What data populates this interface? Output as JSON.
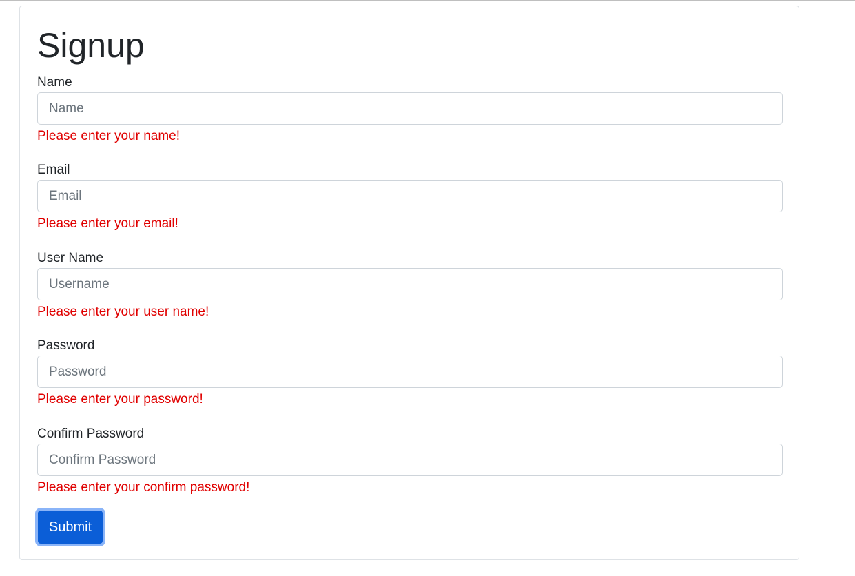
{
  "form": {
    "title": "Signup",
    "fields": [
      {
        "label": "Name",
        "placeholder": "Name",
        "value": "",
        "error": "Please enter your name!"
      },
      {
        "label": "Email",
        "placeholder": "Email",
        "value": "",
        "error": "Please enter your email!"
      },
      {
        "label": "User Name",
        "placeholder": "Username",
        "value": "",
        "error": "Please enter your user name!"
      },
      {
        "label": "Password",
        "placeholder": "Password",
        "value": "",
        "error": "Please enter your password!"
      },
      {
        "label": "Confirm Password",
        "placeholder": "Confirm Password",
        "value": "",
        "error": "Please enter your confirm password!"
      }
    ],
    "submit_label": "Submit"
  },
  "colors": {
    "primary": "#0b5ed7",
    "focus_ring": "#8ab4f8",
    "error": "#e00000",
    "border": "#ced4da",
    "text": "#212529",
    "placeholder": "#6c757d"
  }
}
